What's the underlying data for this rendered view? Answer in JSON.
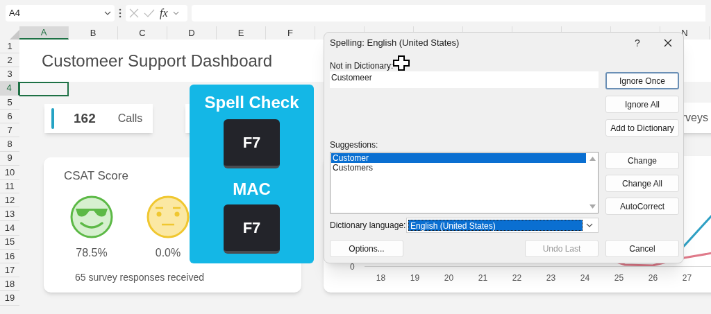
{
  "formula_bar": {
    "name_box": "A4",
    "function_label": "fx"
  },
  "column_headers": [
    {
      "label": "A",
      "selected": true
    },
    {
      "label": "B",
      "selected": false
    },
    {
      "label": "C",
      "selected": false
    },
    {
      "label": "D",
      "selected": false
    },
    {
      "label": "E",
      "selected": false
    },
    {
      "label": "F",
      "selected": false
    }
  ],
  "right_column_headers": [
    {
      "label": "N",
      "selected": false
    }
  ],
  "row_headers": [
    {
      "label": "1",
      "selected": false
    },
    {
      "label": "2",
      "selected": false
    },
    {
      "label": "3",
      "selected": false
    },
    {
      "label": "4",
      "selected": true
    },
    {
      "label": "5",
      "selected": false
    },
    {
      "label": "6",
      "selected": false
    },
    {
      "label": "7",
      "selected": false
    },
    {
      "label": "8",
      "selected": false
    },
    {
      "label": "9",
      "selected": false
    },
    {
      "label": "10",
      "selected": false
    },
    {
      "label": "11",
      "selected": false
    },
    {
      "label": "12",
      "selected": false
    },
    {
      "label": "13",
      "selected": false
    },
    {
      "label": "14",
      "selected": false
    },
    {
      "label": "15",
      "selected": false
    },
    {
      "label": "16",
      "selected": false
    },
    {
      "label": "17",
      "selected": false
    },
    {
      "label": "18",
      "selected": false
    },
    {
      "label": "19",
      "selected": false
    }
  ],
  "sheet": {
    "title": "Customeer Support Dashboard",
    "calls_card": {
      "value": "162",
      "label": "Calls"
    },
    "surveys_card": {
      "label": "rveys"
    },
    "csat_card": {
      "title": "CSAT Score",
      "faces": [
        {
          "kind": "cool",
          "value": "78.5%"
        },
        {
          "kind": "neutral",
          "value": "0.0%"
        }
      ],
      "footer": "65 survey responses received"
    },
    "chart": {
      "y_tick": "0",
      "x_labels": [
        "18",
        "19",
        "20",
        "21",
        "22",
        "23",
        "24",
        "25",
        "26",
        "27"
      ]
    }
  },
  "overlay": {
    "title": "Spell Check",
    "keys": [
      {
        "label": "F7"
      }
    ],
    "mac_title": "MAC",
    "mac_keys": [
      {
        "label": "F7"
      }
    ]
  },
  "dialog": {
    "title": "Spelling: English (United States)",
    "help": "?",
    "not_in_dictionary_label": "Not in Dictionary:",
    "not_in_dictionary_value": "Customeer",
    "suggestions_label": "Suggestions:",
    "suggestions": [
      {
        "text": "Customer",
        "selected": true
      },
      {
        "text": "Customers",
        "selected": false
      }
    ],
    "dictionary_language_label": "Dictionary language:",
    "dictionary_language": "English (United States)",
    "side_buttons": [
      {
        "label": "Ignore Once",
        "focused": true
      },
      {
        "label": "Ignore All",
        "focused": false
      },
      {
        "label": "Add to Dictionary",
        "focused": false
      }
    ],
    "change_buttons": [
      {
        "label": "Change"
      },
      {
        "label": "Change All"
      },
      {
        "label": "AutoCorrect"
      }
    ],
    "options_button": "Options...",
    "undo_button": {
      "label": "Undo Last",
      "disabled": true
    },
    "cancel_button": "Cancel"
  }
}
